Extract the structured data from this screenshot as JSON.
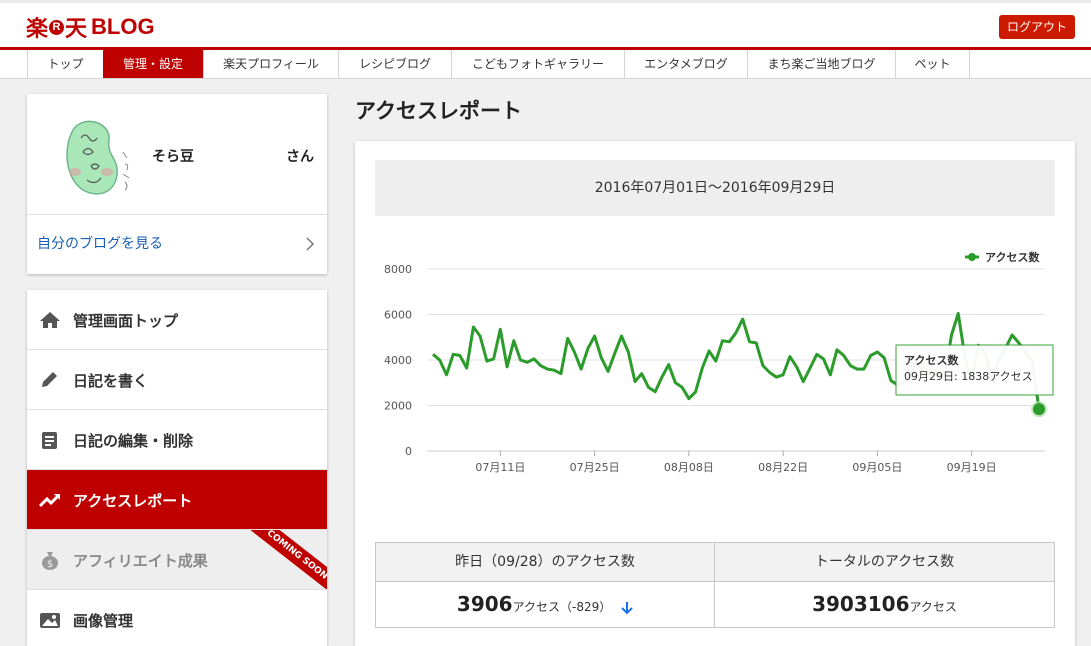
{
  "header": {
    "logo_left": "楽",
    "logo_r": "R",
    "logo_right": "天",
    "logo_blog": "BLOG",
    "logout_label": "ログアウト"
  },
  "nav": {
    "items": [
      {
        "label": "トップ",
        "active": false
      },
      {
        "label": "管理・設定",
        "active": true
      },
      {
        "label": "楽天プロフィール",
        "active": false
      },
      {
        "label": "レシピブログ",
        "active": false
      },
      {
        "label": "こどもフォトギャラリー",
        "active": false
      },
      {
        "label": "エンタメブログ",
        "active": false
      },
      {
        "label": "まち楽ご当地ブログ",
        "active": false
      },
      {
        "label": "ペット",
        "active": false
      }
    ]
  },
  "profile": {
    "name": "そら豆",
    "suffix": "さん",
    "my_blog_link": "自分のブログを見る"
  },
  "sidebar": {
    "items": [
      {
        "label": "管理画面トップ",
        "icon": "home-icon",
        "state": "normal"
      },
      {
        "label": "日記を書く",
        "icon": "pencil-icon",
        "state": "normal"
      },
      {
        "label": "日記の編集・削除",
        "icon": "document-icon",
        "state": "normal"
      },
      {
        "label": "アクセスレポート",
        "icon": "trend-icon",
        "state": "active"
      },
      {
        "label": "アフィリエイト成果",
        "icon": "money-bag-icon",
        "state": "disabled",
        "ribbon": "COMING SOON"
      },
      {
        "label": "画像管理",
        "icon": "image-icon",
        "state": "normal"
      }
    ]
  },
  "main": {
    "title": "アクセスレポート",
    "date_range": "2016年07月01日～2016年09月29日",
    "tooltip": {
      "title": "アクセス数",
      "text": "09月29日: 1838アクセス"
    }
  },
  "chart_data": {
    "type": "line",
    "legend": [
      "アクセス数"
    ],
    "legend_position": "top-right",
    "ylim": [
      0,
      8000
    ],
    "yticks": [
      0,
      2000,
      4000,
      6000,
      8000
    ],
    "xtick_labels": [
      "07月11日",
      "07月25日",
      "08月08日",
      "08月22日",
      "09月05日",
      "09月19日"
    ],
    "series": [
      {
        "name": "アクセス数",
        "color": "#2b9b2b",
        "x": [
          "07/01",
          "07/02",
          "07/03",
          "07/04",
          "07/05",
          "07/06",
          "07/07",
          "07/08",
          "07/09",
          "07/10",
          "07/11",
          "07/12",
          "07/13",
          "07/14",
          "07/15",
          "07/16",
          "07/17",
          "07/18",
          "07/19",
          "07/20",
          "07/21",
          "07/22",
          "07/23",
          "07/24",
          "07/25",
          "07/26",
          "07/27",
          "07/28",
          "07/29",
          "07/30",
          "07/31",
          "08/01",
          "08/02",
          "08/03",
          "08/04",
          "08/05",
          "08/06",
          "08/07",
          "08/08",
          "08/09",
          "08/10",
          "08/11",
          "08/12",
          "08/13",
          "08/14",
          "08/15",
          "08/16",
          "08/17",
          "08/18",
          "08/19",
          "08/20",
          "08/21",
          "08/22",
          "08/23",
          "08/24",
          "08/25",
          "08/26",
          "08/27",
          "08/28",
          "08/29",
          "08/30",
          "08/31",
          "09/01",
          "09/02",
          "09/03",
          "09/04",
          "09/05",
          "09/06",
          "09/07",
          "09/08",
          "09/09",
          "09/10",
          "09/11",
          "09/12",
          "09/13",
          "09/14",
          "09/15",
          "09/16",
          "09/17",
          "09/18",
          "09/19",
          "09/20",
          "09/21",
          "09/22",
          "09/23",
          "09/24",
          "09/25",
          "09/26",
          "09/27",
          "09/28",
          "09/29"
        ],
        "values": [
          4250,
          4000,
          3350,
          4250,
          4200,
          3650,
          5450,
          5050,
          3950,
          4050,
          5350,
          3700,
          4850,
          4000,
          3900,
          4050,
          3750,
          3600,
          3550,
          3400,
          4950,
          4350,
          3600,
          4500,
          5050,
          4100,
          3500,
          4300,
          5050,
          4350,
          3050,
          3400,
          2800,
          2600,
          3250,
          3800,
          3000,
          2800,
          2300,
          2600,
          3650,
          4400,
          3950,
          4850,
          4800,
          5200,
          5800,
          4800,
          4750,
          3750,
          3450,
          3250,
          3350,
          4150,
          3700,
          3050,
          3650,
          4250,
          4050,
          3350,
          4450,
          4200,
          3750,
          3600,
          3600,
          4200,
          4350,
          4100,
          3100,
          2900,
          3050,
          3400,
          3900,
          3300,
          3550,
          3300,
          3250,
          5100,
          6050,
          4150,
          3000,
          4650,
          4300,
          3150,
          4000,
          4500,
          5100,
          4750,
          4350,
          3906,
          1838
        ]
      }
    ]
  },
  "stats": {
    "yesterday_header": "昨日（09/28）のアクセス数",
    "total_header": "トータルのアクセス数",
    "yesterday_value": "3906",
    "yesterday_unit": "アクセス（-829）",
    "total_value": "3903106",
    "total_unit": "アクセス"
  },
  "colors": {
    "brand_red": "#bf0000",
    "line_green": "#2b9b2b",
    "link_blue": "#1a5fb4",
    "arrow_blue": "#1a73e8"
  }
}
